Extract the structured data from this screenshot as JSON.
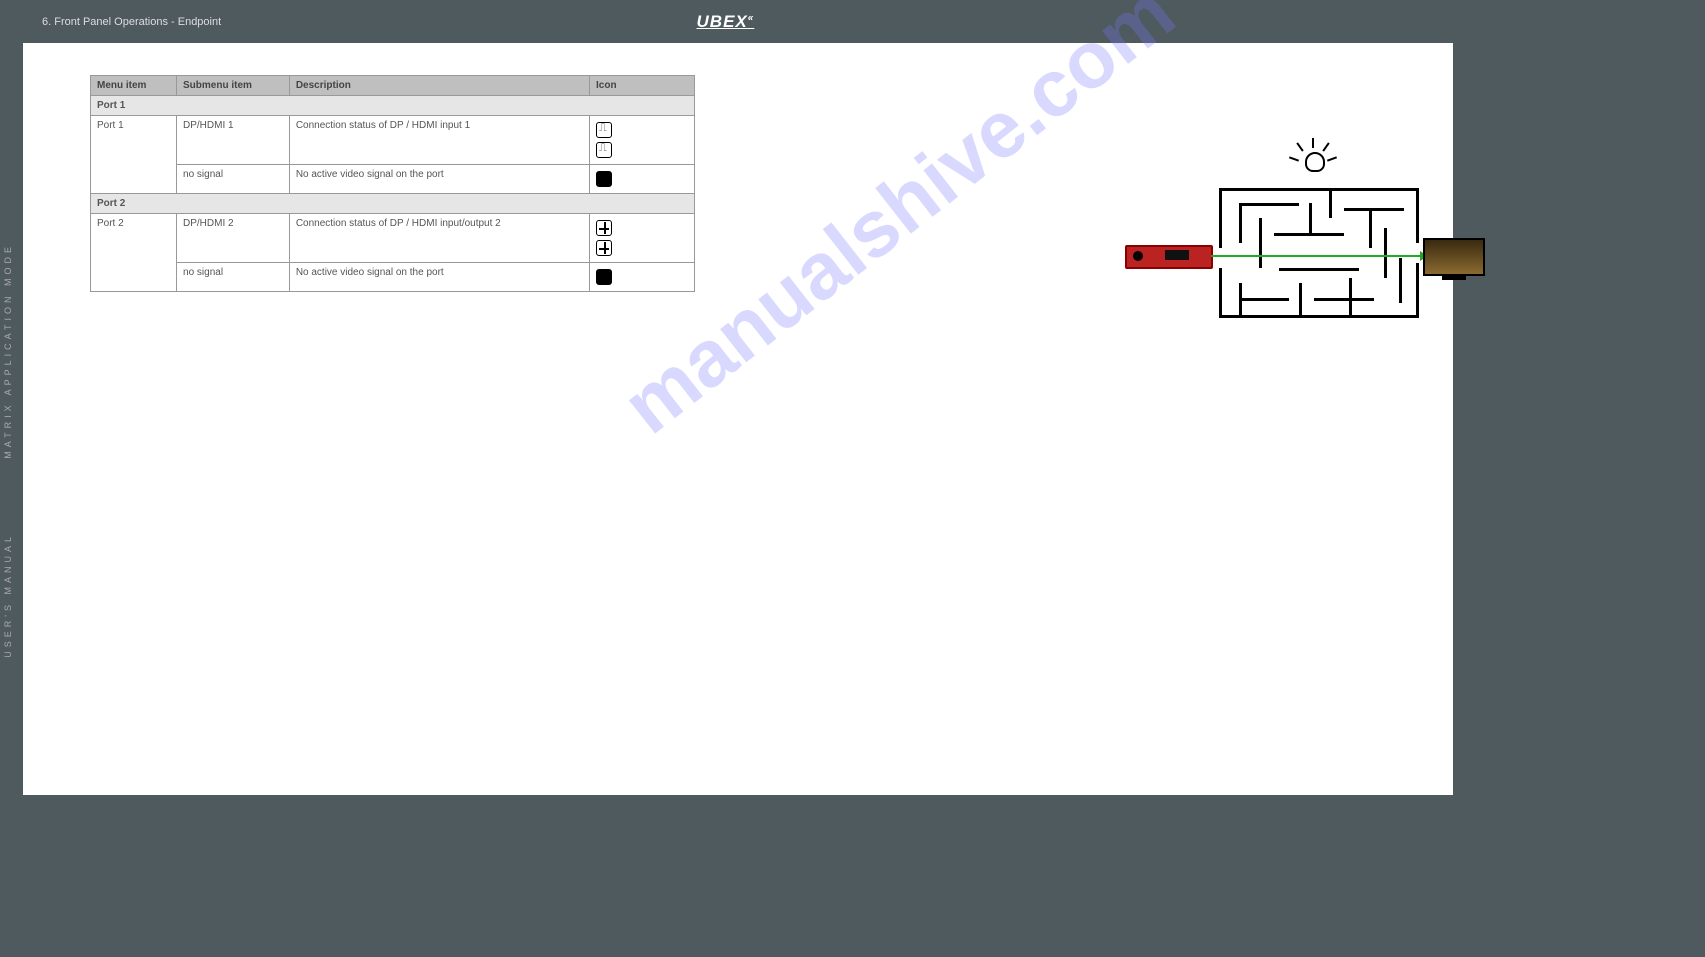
{
  "topbar": {
    "left1": "",
    "left2": "6. Front Panel Operations - Endpoint",
    "brand": "UBEX",
    "right": ""
  },
  "sidebar": {
    "line1": "MATRIX APPLICATION MODE",
    "line2": "USER'S MANUAL"
  },
  "table": {
    "headers": [
      "Menu item",
      "Submenu item",
      "Description",
      "Icon"
    ],
    "section1": "Port 1",
    "rows1": [
      {
        "m": "Port 1",
        "s": "DP/HDMI 1",
        "d": "Connection status of DP / HDMI input 1",
        "icons": [
          "plug",
          "plug"
        ]
      },
      {
        "m": "",
        "s": "no signal",
        "d": "No active video signal on the port",
        "icons": [
          "filled"
        ]
      }
    ],
    "section2": "Port 2",
    "rows2": [
      {
        "m": "Port 2",
        "s": "DP/HDMI 2",
        "d": "Connection status of DP / HDMI input/output 2",
        "icons": [
          "split",
          "split"
        ]
      },
      {
        "m": "",
        "s": "no signal",
        "d": "No active video signal on the port",
        "icons": [
          "filled"
        ]
      }
    ]
  },
  "intro": {
    "heading": "",
    "body": ""
  },
  "watermark": "manualshive.com",
  "chart_data": {
    "type": "table",
    "title": "Front panel port status icons",
    "columns": [
      "Menu item",
      "Submenu item",
      "Description",
      "Icon"
    ],
    "sections": [
      {
        "name": "Port 1",
        "rows": [
          [
            "Port 1",
            "DP/HDMI 1",
            "Connection status of DP / HDMI input 1",
            "plug, plug"
          ],
          [
            "",
            "no signal",
            "No active video signal on the port",
            "filled-square"
          ]
        ]
      },
      {
        "name": "Port 2",
        "rows": [
          [
            "Port 2",
            "DP/HDMI 2",
            "Connection status of DP / HDMI input/output 2",
            "split, split"
          ],
          [
            "",
            "no signal",
            "No active video signal on the port",
            "filled-square"
          ]
        ]
      }
    ]
  }
}
